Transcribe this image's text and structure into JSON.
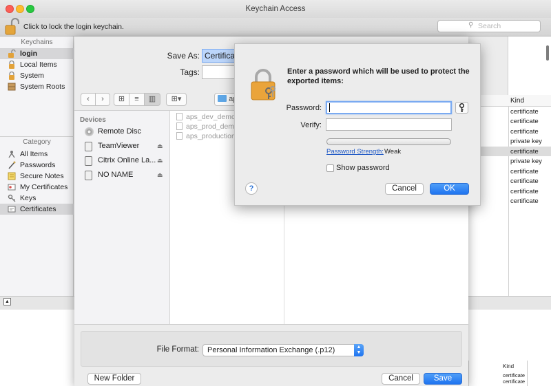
{
  "window": {
    "title": "Keychain Access",
    "lock_hint": "Click to lock the login keychain.",
    "search_placeholder": "Search"
  },
  "sidebar": {
    "keychains_heading": "Keychains",
    "keychains": [
      {
        "label": "login",
        "icon": "lock-open-icon",
        "selected": true
      },
      {
        "label": "Local Items",
        "icon": "lock-icon"
      },
      {
        "label": "System",
        "icon": "lock-icon"
      },
      {
        "label": "System Roots",
        "icon": "cabinet-icon"
      }
    ],
    "category_heading": "Category",
    "categories": [
      {
        "label": "All Items",
        "icon": "all-items-icon"
      },
      {
        "label": "Passwords",
        "icon": "passwords-icon"
      },
      {
        "label": "Secure Notes",
        "icon": "secure-notes-icon"
      },
      {
        "label": "My Certificates",
        "icon": "my-certificates-icon"
      },
      {
        "label": "Keys",
        "icon": "keys-icon"
      },
      {
        "label": "Certificates",
        "icon": "certificates-icon",
        "selected": true
      }
    ]
  },
  "list": {
    "kind_header": "Kind",
    "kinds": [
      "certificate",
      "certificate",
      "certificate",
      "private key",
      "certificate",
      "private key",
      "certificate",
      "certificate",
      "certificate",
      "certificate"
    ],
    "lower_kind_header": "Kind",
    "lower_kinds": [
      "certificate",
      "certificate"
    ]
  },
  "save_panel": {
    "save_as_label": "Save As:",
    "save_as_value": "Certificat",
    "tags_label": "Tags:",
    "folder_label": "ap",
    "devices_heading": "Devices",
    "devices": [
      {
        "label": "Remote Disc",
        "icon": "disc-icon",
        "eject": false
      },
      {
        "label": "TeamViewer",
        "icon": "drive-icon",
        "eject": true
      },
      {
        "label": "Citrix Online La...",
        "icon": "drive-icon",
        "eject": true
      },
      {
        "label": "NO NAME",
        "icon": "drive-icon",
        "eject": true
      }
    ],
    "files": [
      "aps_dev_demo.",
      "aps_prod_demo",
      "aps_production"
    ],
    "file_format_label": "File Format:",
    "file_format_value": "Personal Information Exchange (.p12)",
    "new_folder_label": "New Folder",
    "cancel_label": "Cancel",
    "save_label": "Save"
  },
  "password_dialog": {
    "message": "Enter a password which will be used to protect the exported items:",
    "password_label": "Password:",
    "password_value": "",
    "verify_label": "Verify:",
    "verify_value": "",
    "strength_label": "Password Strength:",
    "strength_value": "Weak",
    "show_password_label": "Show password",
    "show_password_checked": false,
    "help_label": "?",
    "cancel_label": "Cancel",
    "ok_label": "OK"
  },
  "colors": {
    "accent_blue": "#1f74f0",
    "link_blue": "#1a55c4",
    "selection_gray": "#d8d8d8"
  }
}
